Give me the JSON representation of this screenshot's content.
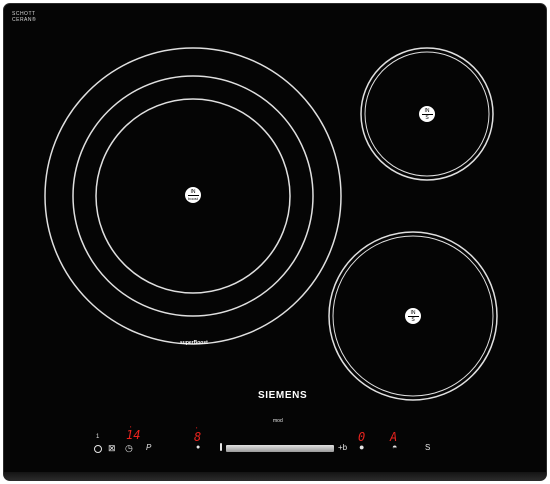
{
  "brand": {
    "schott_ceran": [
      "SCHOTT",
      "CERAN®"
    ],
    "maker": "SIEMENS"
  },
  "zones": {
    "large": {
      "badge_top": "IN",
      "badge_bottom": "boost",
      "label": "superBoost"
    },
    "rear_right": {
      "badge_top": "IN",
      "badge_bottom": "S"
    },
    "front_right": {
      "badge_top": "IN",
      "badge_bottom": "S"
    }
  },
  "controls": {
    "display_left_value": "14",
    "display_center_value": "8",
    "display_right_1": "0",
    "display_right_2": "A",
    "indicator_left": "1",
    "center_label": "mod",
    "p_button": "P",
    "s_button": "S",
    "slider_min": "0",
    "slider_max": "+b"
  },
  "colors": {
    "panel": "#050505",
    "ring": "#e0e0e0",
    "display_red": "#e8231e"
  }
}
